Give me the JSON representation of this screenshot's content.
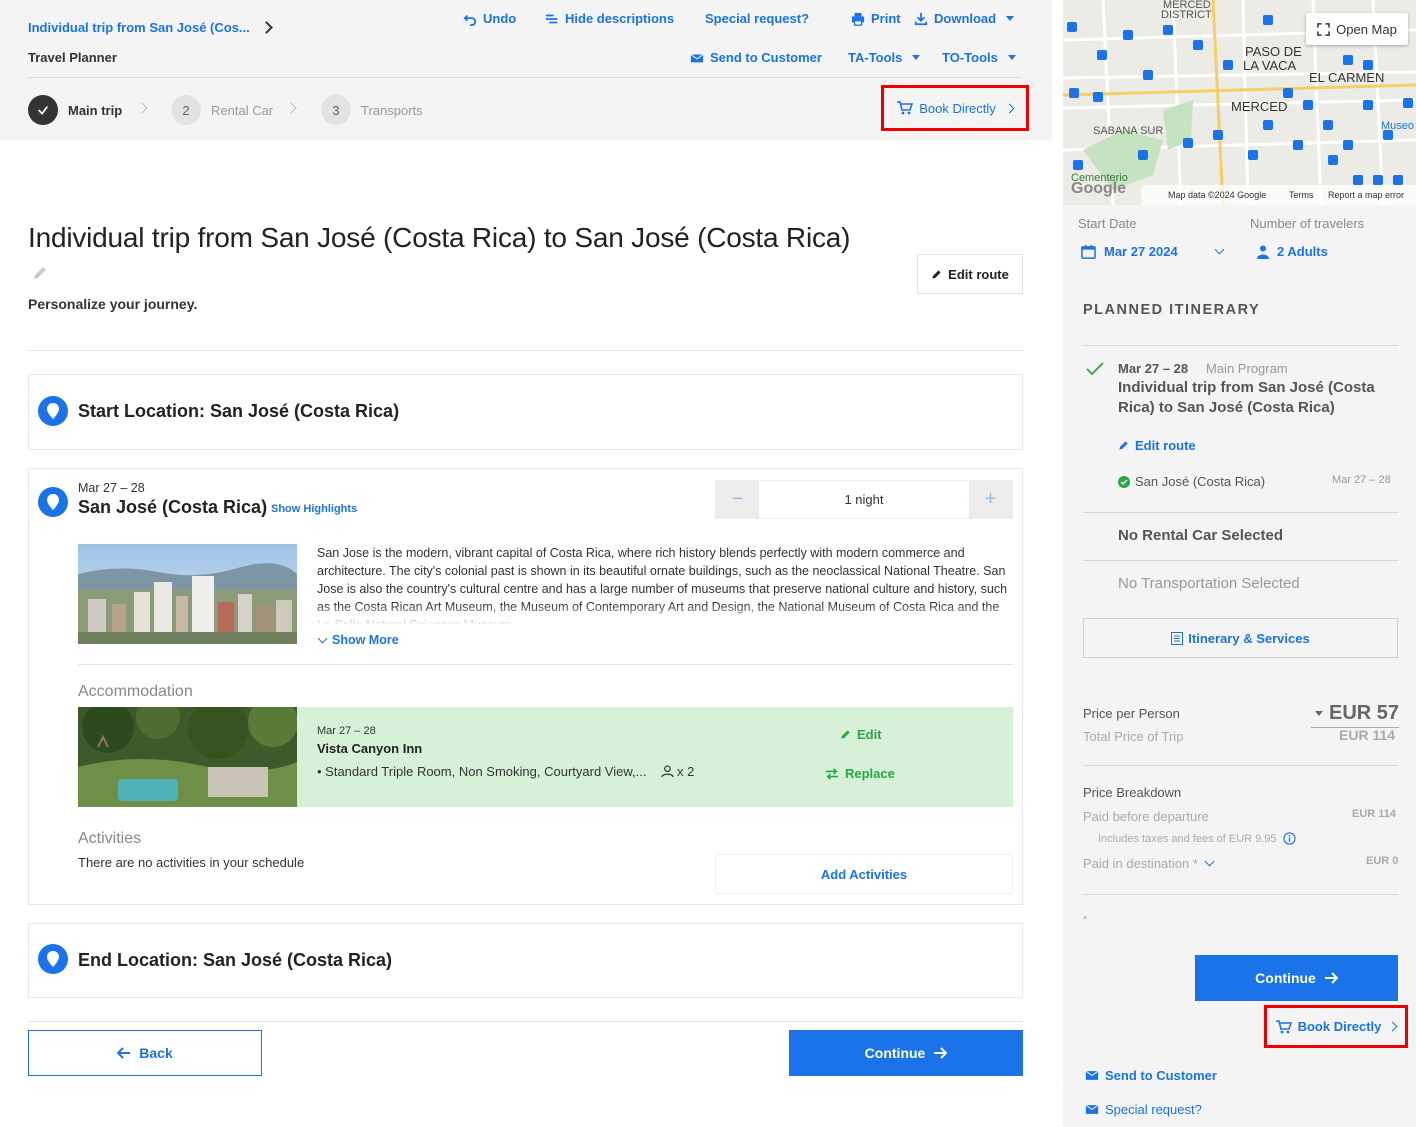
{
  "header": {
    "breadcrumb": "Individual trip from San José (Cos...",
    "subtitle": "Travel Planner",
    "tools": {
      "undo": "Undo",
      "hide_descriptions": "Hide descriptions",
      "special_request": "Special request?",
      "print": "Print",
      "download": "Download",
      "send_to_customer": "Send to Customer",
      "ta_tools": "TA-Tools",
      "to_tools": "TO-Tools"
    },
    "steps": [
      {
        "num": "",
        "label": "Main trip"
      },
      {
        "num": "2",
        "label": "Rental Car"
      },
      {
        "num": "3",
        "label": "Transports"
      }
    ],
    "book_directly": "Book Directly"
  },
  "main": {
    "title": "Individual trip from San José (Costa Rica) to San José (Costa Rica)",
    "personalize": "Personalize your journey.",
    "edit_route": "Edit route",
    "start_location": "Start Location: San José (Costa Rica)",
    "stop": {
      "dates": "Mar 27 – 28",
      "city": "San José (Costa Rica)",
      "show_highlights": "Show Highlights",
      "nights": "1 night",
      "minus": "−",
      "plus": "+",
      "description": "San Jose is the modern, vibrant capital of Costa Rica, where rich history blends perfectly with modern commerce and architecture. The city's colonial past is shown in its beautiful ornate buildings, such as the neoclassical National Theatre. San Jose is also the country's cultural centre and has a large number of museums that preserve national culture and history, such as the Costa Rican Art Museum, the Museum of Contemporary Art and Design, the National Museum of Costa Rica and the La Salle Natural Sciences Museum.",
      "show_more": "Show More",
      "accommodation_heading": "Accommodation",
      "hotel": {
        "dates": "Mar 27 – 28",
        "name": "Vista Canyon Inn",
        "room": "• Standard Triple Room, Non Smoking, Courtyard View,...",
        "guests": "x 2",
        "edit": "Edit",
        "replace": "Replace"
      },
      "activities_heading": "Activities",
      "no_activities": "There are no activities in your schedule",
      "add_activities": "Add Activities"
    },
    "end_location": "End Location: San José (Costa Rica)",
    "back": "Back",
    "continue": "Continue"
  },
  "sidebar": {
    "map": {
      "open_map": "Open Map",
      "labels": [
        "MERCED",
        "DISTRICT",
        "PASO DE",
        "LA VACA",
        "EL CARMEN",
        "MERCED",
        "SABANA SUR",
        "Cementerio",
        "Museo"
      ],
      "footer": {
        "map_data": "Map data ©2024 Google",
        "terms": "Terms",
        "report": "Report a map error"
      },
      "google": "Google"
    },
    "start_date_label": "Start Date",
    "start_date": "Mar 27 2024",
    "travelers_label": "Number of travelers",
    "travelers": "2 Adults",
    "itinerary_heading": "PLANNED ITINERARY",
    "item": {
      "dates": "Mar 27 – 28",
      "type": "Main Program",
      "title": "Individual trip from San José (Costa Rica) to San José (Costa Rica)",
      "edit_route": "Edit route",
      "stop_name": "San José (Costa Rica)",
      "stop_dates": "Mar 27 – 28"
    },
    "no_rental": "No Rental Car Selected",
    "no_transport": "No Transportation Selected",
    "itinerary_services": "Itinerary & Services",
    "price_per_person_label": "Price per Person",
    "price_per_person": "EUR 57",
    "total_label": "Total Price of Trip",
    "total": "EUR 114",
    "breakdown_label": "Price Breakdown",
    "paid_before_label": "Paid before departure",
    "paid_before": "EUR 114",
    "taxes_note": "Includes taxes and fees of EUR 9.95",
    "paid_dest_label": "Paid in destination *",
    "paid_dest": "EUR 0",
    "asterisk": "*",
    "continue": "Continue",
    "book_directly": "Book Directly",
    "send_to_customer": "Send to Customer",
    "special_request": "Special request?"
  },
  "colors": {
    "accent": "#1a73e8",
    "success": "#27a744",
    "highlight": "#e00000",
    "accommodation_bg": "#d6f1d8"
  }
}
